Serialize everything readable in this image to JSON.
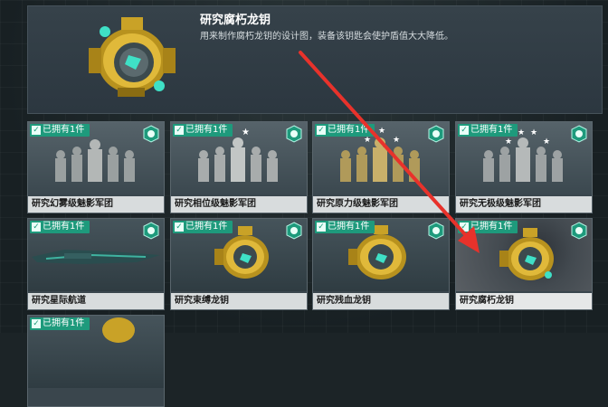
{
  "detail": {
    "title": "研究腐朽龙钥",
    "description": "用来制作腐朽龙钥的设计图，装备该钥匙会使护盾值大大降低。"
  },
  "cards": [
    {
      "label": "研究幻雾级魅影军团",
      "owned": "已拥有1件",
      "type": "troop",
      "stars": 0
    },
    {
      "label": "研究相位级魅影军团",
      "owned": "已拥有1件",
      "type": "troop",
      "stars": 1
    },
    {
      "label": "研究原力级魅影军团",
      "owned": "已拥有1件",
      "type": "troop",
      "stars": 3
    },
    {
      "label": "研究无极级魅影军团",
      "owned": "已拥有1件",
      "type": "troop",
      "stars": 4
    },
    {
      "label": "研究星际航道",
      "owned": "已拥有1件",
      "type": "ship"
    },
    {
      "label": "研究束缚龙钥",
      "owned": "已拥有1件",
      "type": "key"
    },
    {
      "label": "研究残血龙钥",
      "owned": "已拥有1件",
      "type": "key"
    },
    {
      "label": "研究腐朽龙钥",
      "owned": "已拥有1件",
      "type": "key",
      "selected": true
    },
    {
      "label": "",
      "owned": "已拥有1件",
      "type": "key"
    }
  ],
  "colors": {
    "owned_badge": "#1e9a7c",
    "arrow": "#e8322b",
    "gold": "#c9a227",
    "teal": "#2fd2b8"
  }
}
